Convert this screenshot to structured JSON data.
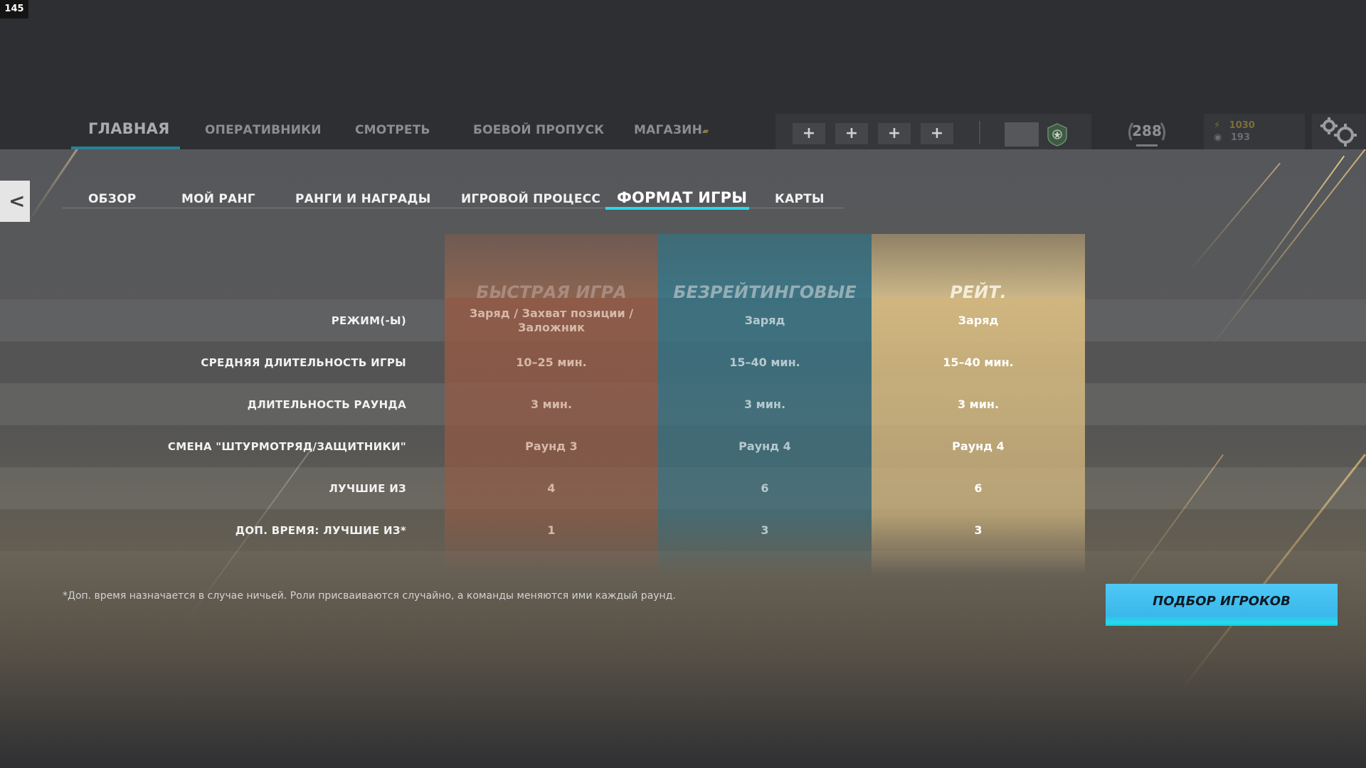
{
  "overlay": {
    "fps": "145"
  },
  "nav": {
    "tabs": [
      {
        "label": "ГЛАВНАЯ",
        "active": true
      },
      {
        "label": "ОПЕРАТИВНИКИ",
        "active": false
      },
      {
        "label": "СМОТРЕТЬ",
        "active": false
      },
      {
        "label": "БОЕВОЙ ПРОПУСК",
        "active": false
      },
      {
        "label": "МАГАЗИН",
        "active": false
      }
    ],
    "squad_slots": [
      "+",
      "+",
      "+",
      "+"
    ],
    "level": "288",
    "currency": {
      "renown": "1030",
      "credits": "193"
    }
  },
  "subnav": {
    "tabs": [
      {
        "label": "ОБЗОР",
        "active": false
      },
      {
        "label": "МОЙ РАНГ",
        "active": false
      },
      {
        "label": "РАНГИ И НАГРАДЫ",
        "active": false
      },
      {
        "label": "ИГРОВОЙ ПРОЦЕСС",
        "active": false
      },
      {
        "label": "ФОРМАТ ИГРЫ",
        "active": true
      },
      {
        "label": "КАРТЫ",
        "active": false
      }
    ]
  },
  "table": {
    "columns": [
      {
        "title": "БЫСТРАЯ ИГРА",
        "color": "#bd6c4e"
      },
      {
        "title": "БЕЗРЕЙТИНГОВЫЕ",
        "color": "#3b7d8f"
      },
      {
        "title": "РЕЙТ.",
        "color": "#dcc088"
      }
    ],
    "rows": [
      {
        "label": "РЕЖИМ(-Ы)",
        "values": [
          "Заряд / Захват позиции / Заложник",
          "Заряд",
          "Заряд"
        ]
      },
      {
        "label": "СРЕДНЯЯ ДЛИТЕЛЬНОСТЬ ИГРЫ",
        "values": [
          "10–25 мин.",
          "15–40 мин.",
          "15–40 мин."
        ]
      },
      {
        "label": "ДЛИТЕЛЬНОСТЬ РАУНДА",
        "values": [
          "3 мин.",
          "3 мин.",
          "3 мин."
        ]
      },
      {
        "label": "СМЕНА \"ШТУРМОТРЯД/ЗАЩИТНИКИ\"",
        "values": [
          "Раунд 3",
          "Раунд 4",
          "Раунд 4"
        ]
      },
      {
        "label": "ЛУЧШИЕ ИЗ",
        "values": [
          "4",
          "6",
          "6"
        ]
      },
      {
        "label": "ДОП. ВРЕМЯ: ЛУЧШИЕ ИЗ*",
        "values": [
          "1",
          "3",
          "3"
        ]
      }
    ]
  },
  "footnote": "*Доп. время назначается в случае ничьей. Роли присваиваются случайно, а команды меняются ими каждый раунд.",
  "matchmaking_button": "ПОДБОР ИГРОКОВ",
  "colors": {
    "accent": "#28d9ee",
    "button": "#3ab8ea"
  }
}
